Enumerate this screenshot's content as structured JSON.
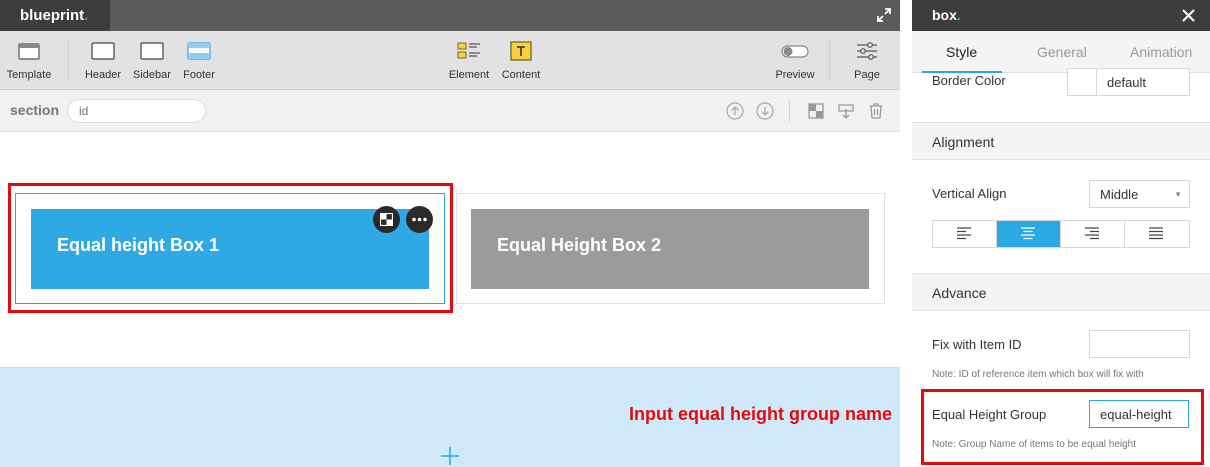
{
  "editor": {
    "brand": "blueprint",
    "brand_dot": ".",
    "toolbar": {
      "template": "Template",
      "header": "Header",
      "sidebar": "Sidebar",
      "footer": "Footer",
      "element": "Element",
      "content": "Content",
      "preview": "Preview",
      "page": "Page"
    },
    "section_label": "section",
    "id_placeholder": "id",
    "canvas": {
      "box1_title": "Equal height Box 1",
      "box2_title": "Equal Height Box 2",
      "annotation": "Input equal height group name"
    }
  },
  "panel": {
    "title": "box",
    "title_dot": ".",
    "tabs": [
      {
        "label": "Style",
        "active": true
      },
      {
        "label": "General",
        "active": false
      },
      {
        "label": "Animation",
        "active": false
      }
    ],
    "border_color": {
      "label": "Border Color",
      "value": "default"
    },
    "alignment": {
      "heading": "Alignment",
      "vertical_align_label": "Vertical Align",
      "vertical_align_value": "Middle",
      "horizontal_selected": "center"
    },
    "advance": {
      "heading": "Advance",
      "fix_label": "Fix with Item ID",
      "fix_value": "",
      "fix_note": "Note: ID of reference item which box will fix with",
      "group_label": "Equal Height Group",
      "group_value": "equal-height",
      "group_note": "Note: Group Name of items to be equal height"
    }
  },
  "colors": {
    "accent": "#2aa8e4",
    "box1": "#2fa9e3",
    "box2": "#9b9b9b",
    "highlight": "#e30b0b",
    "dropzone": "#cfe9fb"
  }
}
